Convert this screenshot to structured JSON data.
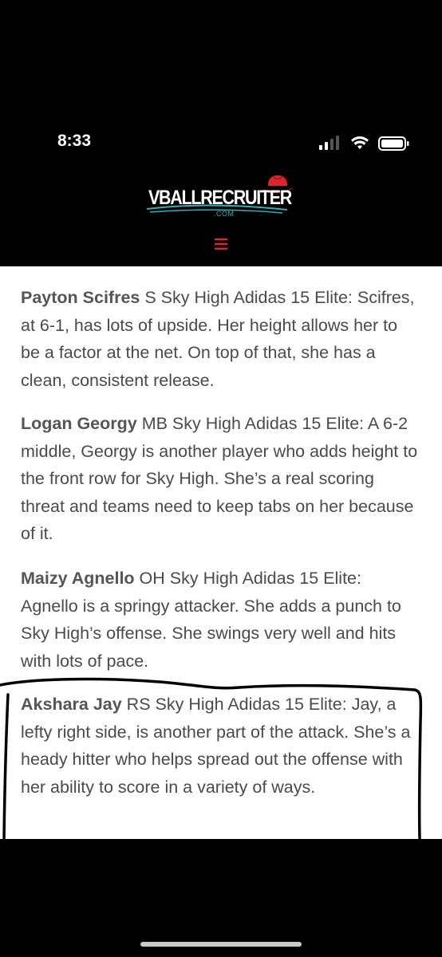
{
  "status_bar": {
    "time": "8:33"
  },
  "site": {
    "logo_text": "VBALLRECRUITER",
    "logo_suffix": ".COM",
    "menu_icon": "hamburger-menu-icon",
    "colors": {
      "accent_red": "#e0242d",
      "logo_teal": "#2bb0b8"
    }
  },
  "article": {
    "players": [
      {
        "name": "Payton Scifres",
        "text": " S Sky High Adidas 15 Elite: Scifres, at 6-1, has lots of upside. Her height allows her to be a factor at the net. On top of that, she has a clean, consistent release."
      },
      {
        "name": "Logan Georgy",
        "text": " MB Sky High Adidas 15 Elite: A 6-2 middle, Georgy is another player who adds height to the front row for Sky High. She’s a real scoring threat and teams need to keep tabs on her because of it."
      },
      {
        "name": "Maizy Agnello",
        "text": " OH Sky High Adidas 15 Elite: Agnello is a springy attacker. She adds a punch to Sky High’s offense. She swings very well and hits with lots of pace."
      },
      {
        "name": "Akshara Jay",
        "text": " RS Sky High Adidas 15 Elite: Jay, a lefty right side, is another part of the attack. She’s a heady hitter who helps spread out the offense with her ability to score in a variety of ways."
      }
    ]
  }
}
